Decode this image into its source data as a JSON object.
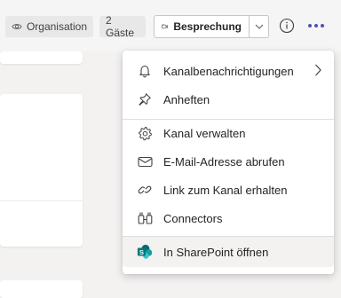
{
  "header": {
    "organisation_label": "Organisation",
    "guests_label": "2 Gäste",
    "meeting_label": "Besprechung"
  },
  "menu": {
    "items": [
      {
        "label": "Kanalbenachrichtigungen",
        "icon": "bell-icon"
      },
      {
        "label": "Anheften",
        "icon": "pin-icon"
      },
      {
        "label": "Kanal verwalten",
        "icon": "gear-icon"
      },
      {
        "label": "E-Mail-Adresse abrufen",
        "icon": "mail-icon"
      },
      {
        "label": "Link zum Kanal erhalten",
        "icon": "link-icon"
      },
      {
        "label": "Connectors",
        "icon": "connectors-icon"
      },
      {
        "label": "In SharePoint öffnen",
        "icon": "sharepoint-icon"
      }
    ]
  },
  "colors": {
    "accent": "#4f52b2",
    "sharepoint_teal": "#036c70"
  }
}
